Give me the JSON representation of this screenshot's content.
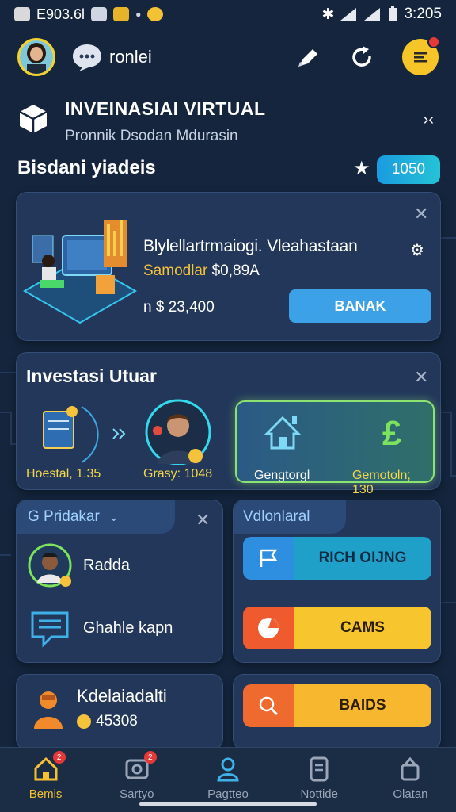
{
  "status_bar": {
    "left_text": "E903.6l",
    "time": "3:205"
  },
  "top_bar": {
    "username": "ronlei"
  },
  "header": {
    "title": "INVEINASIAI VIRTUAL",
    "subtitle": "Pronnik Dsodan Mdurasin"
  },
  "section": {
    "title": "Bisdani yiadeis",
    "score": "1050"
  },
  "promo_card": {
    "title": "Blylellartrmaiogi. Vleahastaan",
    "sub_gold": "Samodlar",
    "sub_price": "$0,89A",
    "price_line": "n $ 23,400",
    "button_label": "BANAK"
  },
  "invest_card": {
    "title": "Investasi Utuar",
    "left_label": "Hoestal, 1.35",
    "mid_label": "Grasy: 1048",
    "right_left_label": "Gengtorgl",
    "right_right_label": "Gemotoln; 130"
  },
  "predikar_card": {
    "tab_label": "G Pridakar",
    "items": [
      {
        "label": "Radda"
      },
      {
        "label": "Ghahle kapn"
      }
    ]
  },
  "video_card": {
    "tab_label": "Vdlonlaral",
    "buttons": [
      {
        "label": "RICH OIJNG",
        "accent": "#1fa0c9"
      },
      {
        "label": "CAMS",
        "accent": "#f7c52e"
      }
    ]
  },
  "kd_card": {
    "title": "Kdelaiadalti",
    "coins": "45308"
  },
  "bd_card": {
    "button_label": "BAIDS"
  },
  "bottom_nav": [
    {
      "label": "Bemis",
      "icon": "home-icon",
      "badge": "2"
    },
    {
      "label": "Sartyo",
      "icon": "camera-icon",
      "badge": "2"
    },
    {
      "label": "Pagtteo",
      "icon": "user-icon",
      "badge": ""
    },
    {
      "label": "Nottide",
      "icon": "wallet-icon",
      "badge": ""
    },
    {
      "label": "Olatan",
      "icon": "profile-icon",
      "badge": ""
    }
  ],
  "colors": {
    "accent_yellow": "#f5c031",
    "accent_blue": "#3ca1e6",
    "accent_green": "#8ce36f",
    "background": "#14253d"
  }
}
